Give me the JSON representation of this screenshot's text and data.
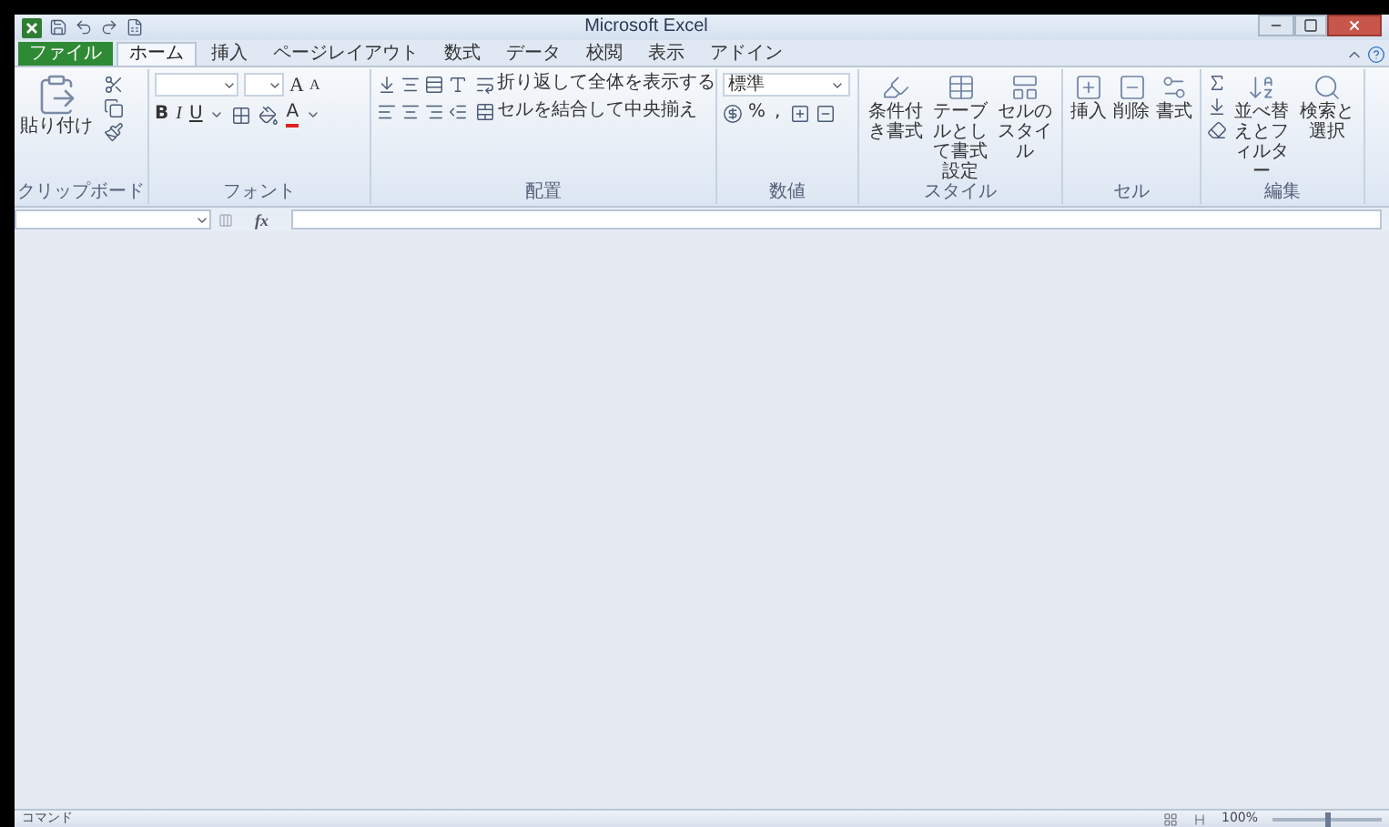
{
  "window": {
    "title": "Microsoft Excel"
  },
  "tabs": [
    {
      "label": "ファイル",
      "kind": "file",
      "selected": false
    },
    {
      "label": "ホーム",
      "kind": "tab",
      "selected": true
    },
    {
      "label": "挿入",
      "kind": "tab",
      "selected": false
    },
    {
      "label": "ページレイアウト",
      "kind": "tab",
      "selected": false
    },
    {
      "label": "数式",
      "kind": "tab",
      "selected": false
    },
    {
      "label": "データ",
      "kind": "tab",
      "selected": false
    },
    {
      "label": "校閲",
      "kind": "tab",
      "selected": false
    },
    {
      "label": "表示",
      "kind": "tab",
      "selected": false
    },
    {
      "label": "アドイン",
      "kind": "tab",
      "selected": false
    }
  ],
  "ribbon": {
    "groups": [
      {
        "kind": "clipboard",
        "label": "クリップボード",
        "paste": "貼り付け"
      },
      {
        "kind": "font",
        "label": "フォント",
        "grow": "A",
        "shrink": "A",
        "bold": "B",
        "italic": "I",
        "underline": "U",
        "font_color": "A"
      },
      {
        "kind": "alignment",
        "label": "配置",
        "wrap": "折り返して全体を表示する",
        "merge": "セルを結合して中央揃え"
      },
      {
        "kind": "number",
        "label": "数値",
        "format": "標準",
        "percent": "%",
        "comma": ","
      },
      {
        "kind": "large",
        "label": "スタイル",
        "buttons": [
          "条件付き書式",
          "テーブルとして書式設定",
          "セルのスタイル"
        ]
      },
      {
        "kind": "large",
        "label": "セル",
        "buttons": [
          "挿入",
          "削除",
          "書式"
        ]
      },
      {
        "kind": "editing",
        "label": "編集",
        "buttons": [
          "並べ替えとフィルター",
          "検索と選択"
        ]
      }
    ]
  },
  "formula_bar": {
    "fx": "fx"
  },
  "status_bar": {
    "mode": "コマンド",
    "zoom": "100%",
    "zoom_slider": {
      "level": 0.5
    }
  }
}
